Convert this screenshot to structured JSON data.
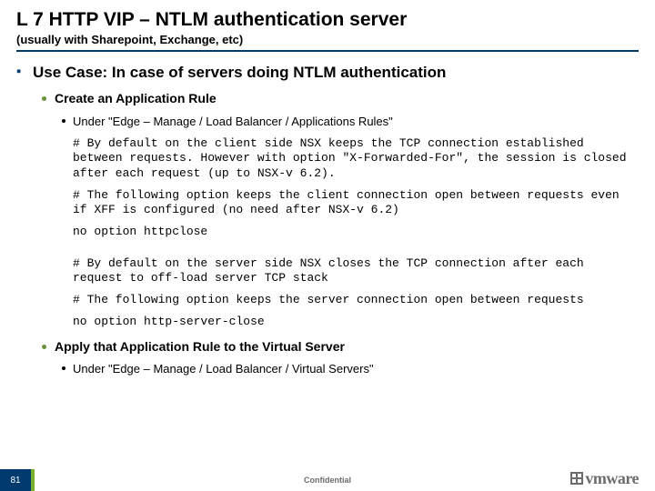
{
  "title_a": "L",
  "title_b": "7 HTTP VIP – NTLM authentication server",
  "subtitle": "(usually with Sharepoint, Exchange, etc)",
  "b1": "Use Case: In case of servers doing NTLM authentication",
  "b2a": "Create an Application Rule",
  "b3a": "Under \"Edge – Manage /  Load Balancer / Applications Rules\"",
  "m1": "# By default on the client side NSX keeps the TCP connection established between requests. However with option \"X-Forwarded-For\", the session is closed after each request (up to NSX-v 6.2).",
  "m2": "# The following option keeps the client connection open between requests even if XFF is configured (no need after NSX-v 6.2)",
  "m3": "no option httpclose",
  "m4": "# By default on the server side NSX closes the TCP connection after each request to off-load server TCP stack",
  "m5": "# The following option keeps the server connection open between requests",
  "m6": "no option http-server-close",
  "b2b": "Apply that Application Rule to the Virtual Server",
  "b3b": "Under \"Edge – Manage /  Load Balancer / Virtual Servers\"",
  "page": "81",
  "conf": "Confidential",
  "brand": "vmware"
}
